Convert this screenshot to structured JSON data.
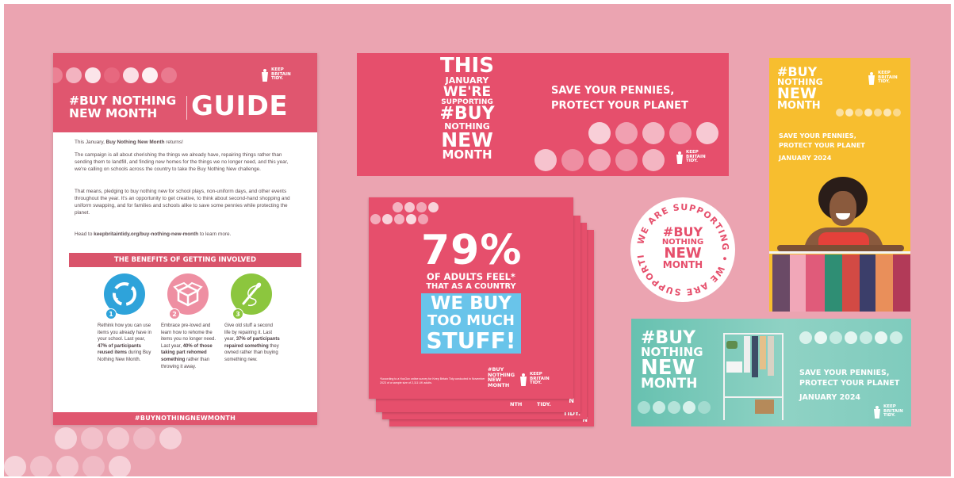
{
  "guide": {
    "title_line1": "#BUY NOTHING",
    "title_line2": "NEW MONTH",
    "title_big": "GUIDE",
    "logo": [
      "KEEP",
      "BRITAIN",
      "TIDY."
    ],
    "p1_pre": "This January, ",
    "p1_bold": "Buy Nothing New Month",
    "p1_post": " returns!",
    "p2": "The campaign is all about cherishing the things we already have, repairing things rather than sending them to landfill, and finding new homes for the things we no longer need, and this year, we're calling on schools across the country to take the Buy Nothing New challenge.",
    "p3": "That means, pledging to buy nothing new for school plays, non-uniform days, and other events throughout the year. It's an opportunity to get creative, to think about second-hand shopping and uniform swapping, and for families and schools alike to save some pennies while protecting the planet.",
    "p4_pre": "Head to ",
    "p4_bold": "keepbritaintidy.org/buy-nothing-new-month",
    "p4_post": " to learn more.",
    "benefits_title": "THE BENEFITS OF GETTING INVOLVED",
    "benefits": [
      {
        "num": "1",
        "text_pre": "Rethink how you can use items you already have in your school. Last year, ",
        "text_bold": "47% of participants reused items",
        "text_post": " during Buy Nothing New Month."
      },
      {
        "num": "2",
        "text_pre": "Embrace pre-loved and learn how to rehome the items you no longer need. Last year, ",
        "text_bold": "40% of those taking part rehomed something",
        "text_post": " rather than throwing it away."
      },
      {
        "num": "3",
        "text_pre": "Give old stuff a second life by repairing it. Last year, ",
        "text_bold": "37% of participants repaired something",
        "text_post": " they owned rather than buying something new."
      }
    ],
    "footer": "#BUYNOTHINGNEWMONTH"
  },
  "banner": {
    "lines": [
      "THIS",
      "JANUARY",
      "WE'RE",
      "SUPPORTING",
      "#BUY",
      "NOTHING",
      "NEW",
      "MONTH"
    ],
    "tagline1": "SAVE YOUR PENNIES,",
    "tagline2": "PROTECT YOUR PLANET",
    "logo": [
      "KEEP",
      "BRITAIN",
      "TIDY."
    ]
  },
  "social": {
    "percent": "79%",
    "line1": "OF ADULTS FEEL*",
    "line2": "THAT AS A COUNTRY",
    "hl1": "WE BUY",
    "hl2": "TOO MUCH",
    "hl3": "STUFF!",
    "footnote": "*According to a YouGov online survey for Keep Britain Tidy conducted in November 2023 of a sample size of 2,111 UK adults.",
    "brand": [
      "#BUY",
      "NOTHING",
      "NEW",
      "MONTH"
    ],
    "logo": [
      "KEEP",
      "BRITAIN",
      "TIDY."
    ],
    "peek": [
      "NTH",
      "TIDY.",
      "N",
      "TIDY.",
      "N"
    ]
  },
  "badge": {
    "ring_text": "WE ARE SUPPORTING • WE ARE SUPPORTING •",
    "lines": [
      "#BUY",
      "NOTHING",
      "NEW",
      "MONTH"
    ]
  },
  "yellow": {
    "lines": [
      "#BUY",
      "NOTHING",
      "NEW",
      "MONTH"
    ],
    "tag1": "SAVE YOUR PENNIES,",
    "tag2": "PROTECT YOUR PLANET",
    "date": "JANUARY 2024",
    "logo": [
      "KEEP",
      "BRITAIN",
      "TIDY."
    ]
  },
  "teal": {
    "lines": [
      "#BUY",
      "NOTHING",
      "NEW",
      "MONTH"
    ],
    "tag1": "SAVE YOUR PENNIES,",
    "tag2": "PROTECT YOUR PLANET",
    "date": "JANUARY 2024",
    "logo": [
      "KEEP",
      "BRITAIN",
      "TIDY."
    ]
  },
  "colors": {
    "background": "#eba4b1",
    "brand_pink": "#e64f6c",
    "yellow": "#f7be2f",
    "teal": "#67c1b0",
    "blue": "#69c4ea",
    "green": "#8cc63e"
  }
}
